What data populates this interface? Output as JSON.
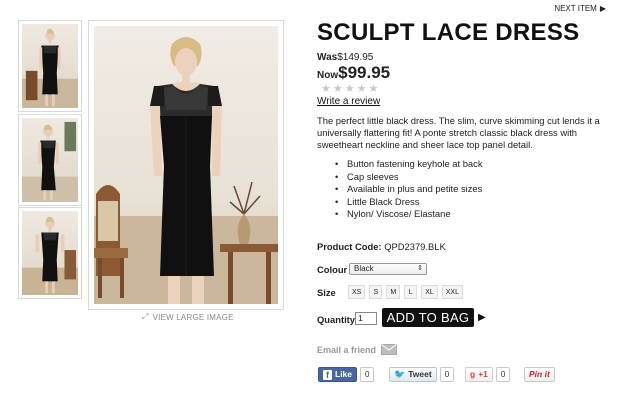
{
  "nav": {
    "next_item": "NEXT ITEM"
  },
  "gallery": {
    "view_large": "VIEW LARGE IMAGE"
  },
  "product": {
    "title": "SCULPT LACE DRESS",
    "was_label": "Was",
    "was_price": "$149.95",
    "now_label": "Now",
    "now_price": "$99.95",
    "rating_stars": 0,
    "review_link": "Write a review",
    "description": "The perfect little black dress. The slim, curve skimming cut lends it a universally flattering fit! A ponte stretch classic black dress with sweetheart neckline and sheer lace top panel detail.",
    "features": [
      "Button fastening keyhole at back",
      "Cap sleeves",
      "Available in plus and petite sizes",
      "Little Black Dress",
      "Nylon/ Viscose/ Elastane"
    ],
    "code_label": "Product Code:",
    "code_value": "QPD2379.BLK",
    "colour_label": "Colour",
    "colour_value": "Black",
    "size_label": "Size",
    "sizes": [
      "XS",
      "S",
      "M",
      "L",
      "XL",
      "XXL"
    ],
    "quantity_label": "Quantity",
    "quantity_value": "1",
    "add_to_bag": "ADD TO BAG",
    "email_friend": "Email a friend"
  },
  "social": {
    "like_label": "Like",
    "like_count": "0",
    "tweet_label": "Tweet",
    "tweet_count": "0",
    "gplus_label": "+1",
    "gplus_count": "0",
    "pin_label": "Pin it"
  },
  "colors": {
    "accent": "#111111",
    "facebook": "#4a66a0",
    "twitter": "#2aa3ef",
    "gplus": "#d34836",
    "pinterest": "#cb2027"
  },
  "icons": {
    "next_arrow": "triangle-right-icon",
    "expand": "expand-icon",
    "email": "envelope-icon"
  }
}
